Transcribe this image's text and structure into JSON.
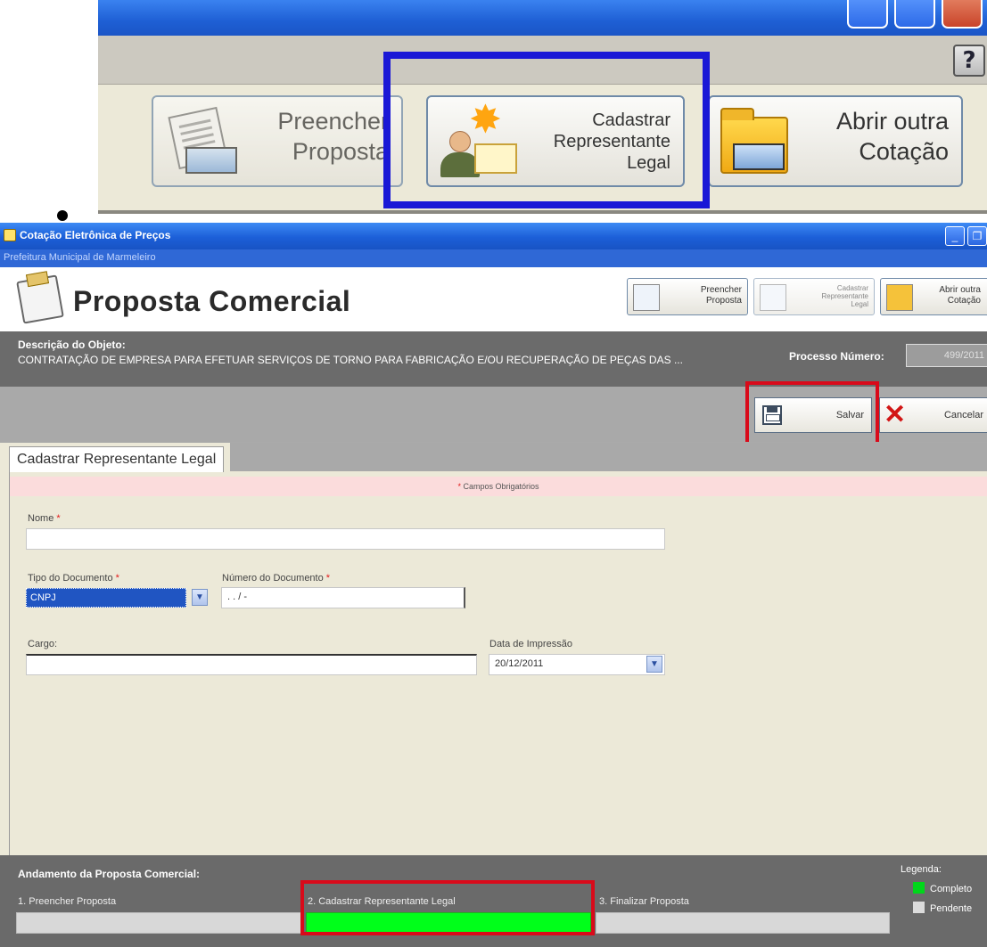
{
  "zoomed": {
    "buttons": [
      {
        "label_line1": "Preencher",
        "label_line2": "Proposta"
      },
      {
        "label_line1": "Cadastrar",
        "label_line2": "Representante",
        "label_line3": "Legal"
      },
      {
        "label_line1": "Abrir outra",
        "label_line2": "Cotação"
      }
    ],
    "help_glyph": "?"
  },
  "window": {
    "title": "Cotação Eletrônica de Preços",
    "subtitle": "Prefeitura Municipal de Marmeleiro",
    "header_title": "Proposta Comercial",
    "toolbar": [
      {
        "line1": "Preencher",
        "line2": "Proposta"
      },
      {
        "line1": "Cadastrar",
        "line2": "Representante",
        "line3": "Legal"
      },
      {
        "line1": "Abrir outra",
        "line2": "Cotação"
      }
    ]
  },
  "description": {
    "label": "Descrição do Objeto:",
    "value": "CONTRATAÇÃO DE EMPRESA PARA EFETUAR SERVIÇOS DE TORNO PARA FABRICAÇÃO E/OU RECUPERAÇÃO DE PEÇAS DAS ...",
    "process_label": "Processo Número:",
    "process_value": "499/2011"
  },
  "actions": {
    "save": "Salvar",
    "cancel": "Cancelar"
  },
  "tab": {
    "label": "Cadastrar Representante Legal"
  },
  "form": {
    "required_notice": "Campos Obrigatórios",
    "required_mark": "*",
    "name_label": "Nome",
    "name_value": "",
    "doc_type_label": "Tipo do Documento",
    "doc_type_value": "CNPJ",
    "doc_number_label": "Número do Documento",
    "doc_number_value": " .   .   /   -",
    "role_label": "Cargo:",
    "role_value": "",
    "print_date_label": "Data de Impressão",
    "print_date_value": "20/12/2011"
  },
  "progress": {
    "title": "Andamento da Proposta Comercial:",
    "steps": [
      {
        "label": "1. Preencher Proposta",
        "status": "pending"
      },
      {
        "label": "2. Cadastrar Representante Legal",
        "status": "complete"
      },
      {
        "label": "3. Finalizar Proposta",
        "status": "pending"
      }
    ],
    "legend_title": "Legenda:",
    "legend": [
      {
        "label": "Completo",
        "color": "#00d61a"
      },
      {
        "label": "Pendente",
        "color": "#dcdcdc"
      }
    ]
  },
  "colors": {
    "highlight_blue": "#1a18d6",
    "highlight_red": "#d90a1a",
    "complete_green": "#00ff1a"
  }
}
